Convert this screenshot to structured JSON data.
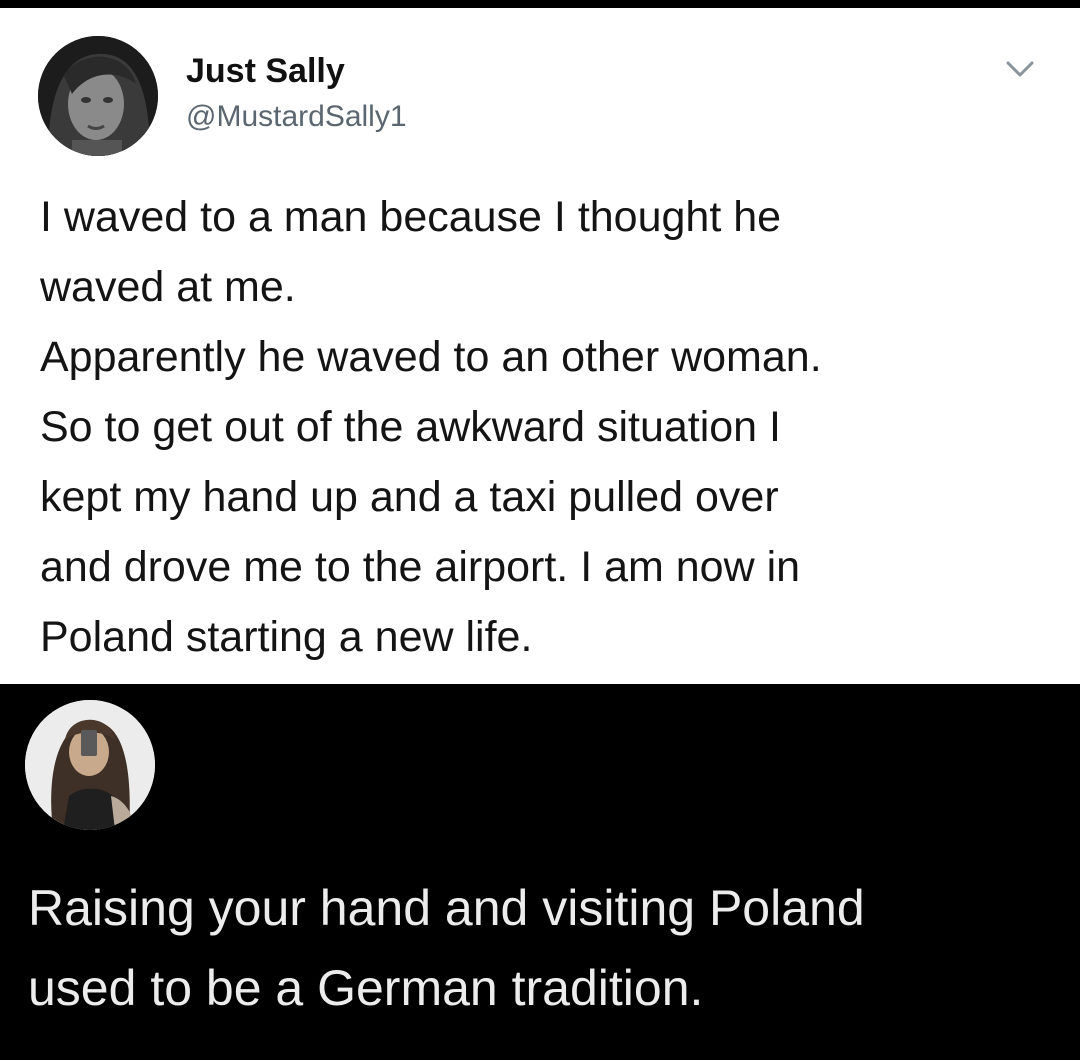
{
  "tweet": {
    "author_name": "Just Sally",
    "author_handle": "@MustardSally1",
    "avatar_icon": "profile-photo-icon",
    "menu_icon": "chevron-down-icon",
    "lines": [
      "I waved to a man because I thought he",
      "waved at me.",
      "Apparently he waved to an other woman.",
      "So to get out of the awkward situation I",
      "kept my hand up and a taxi pulled over",
      "and drove me to the airport. I am now in",
      "Poland starting a new life."
    ]
  },
  "reply": {
    "avatar_icon": "profile-photo-icon",
    "lines": [
      "Raising your hand and visiting Poland",
      "used to be a German tradition."
    ]
  },
  "colors": {
    "tweet_background": "#ffffff",
    "reply_background": "#000000",
    "handle_gray": "#5b6670"
  }
}
